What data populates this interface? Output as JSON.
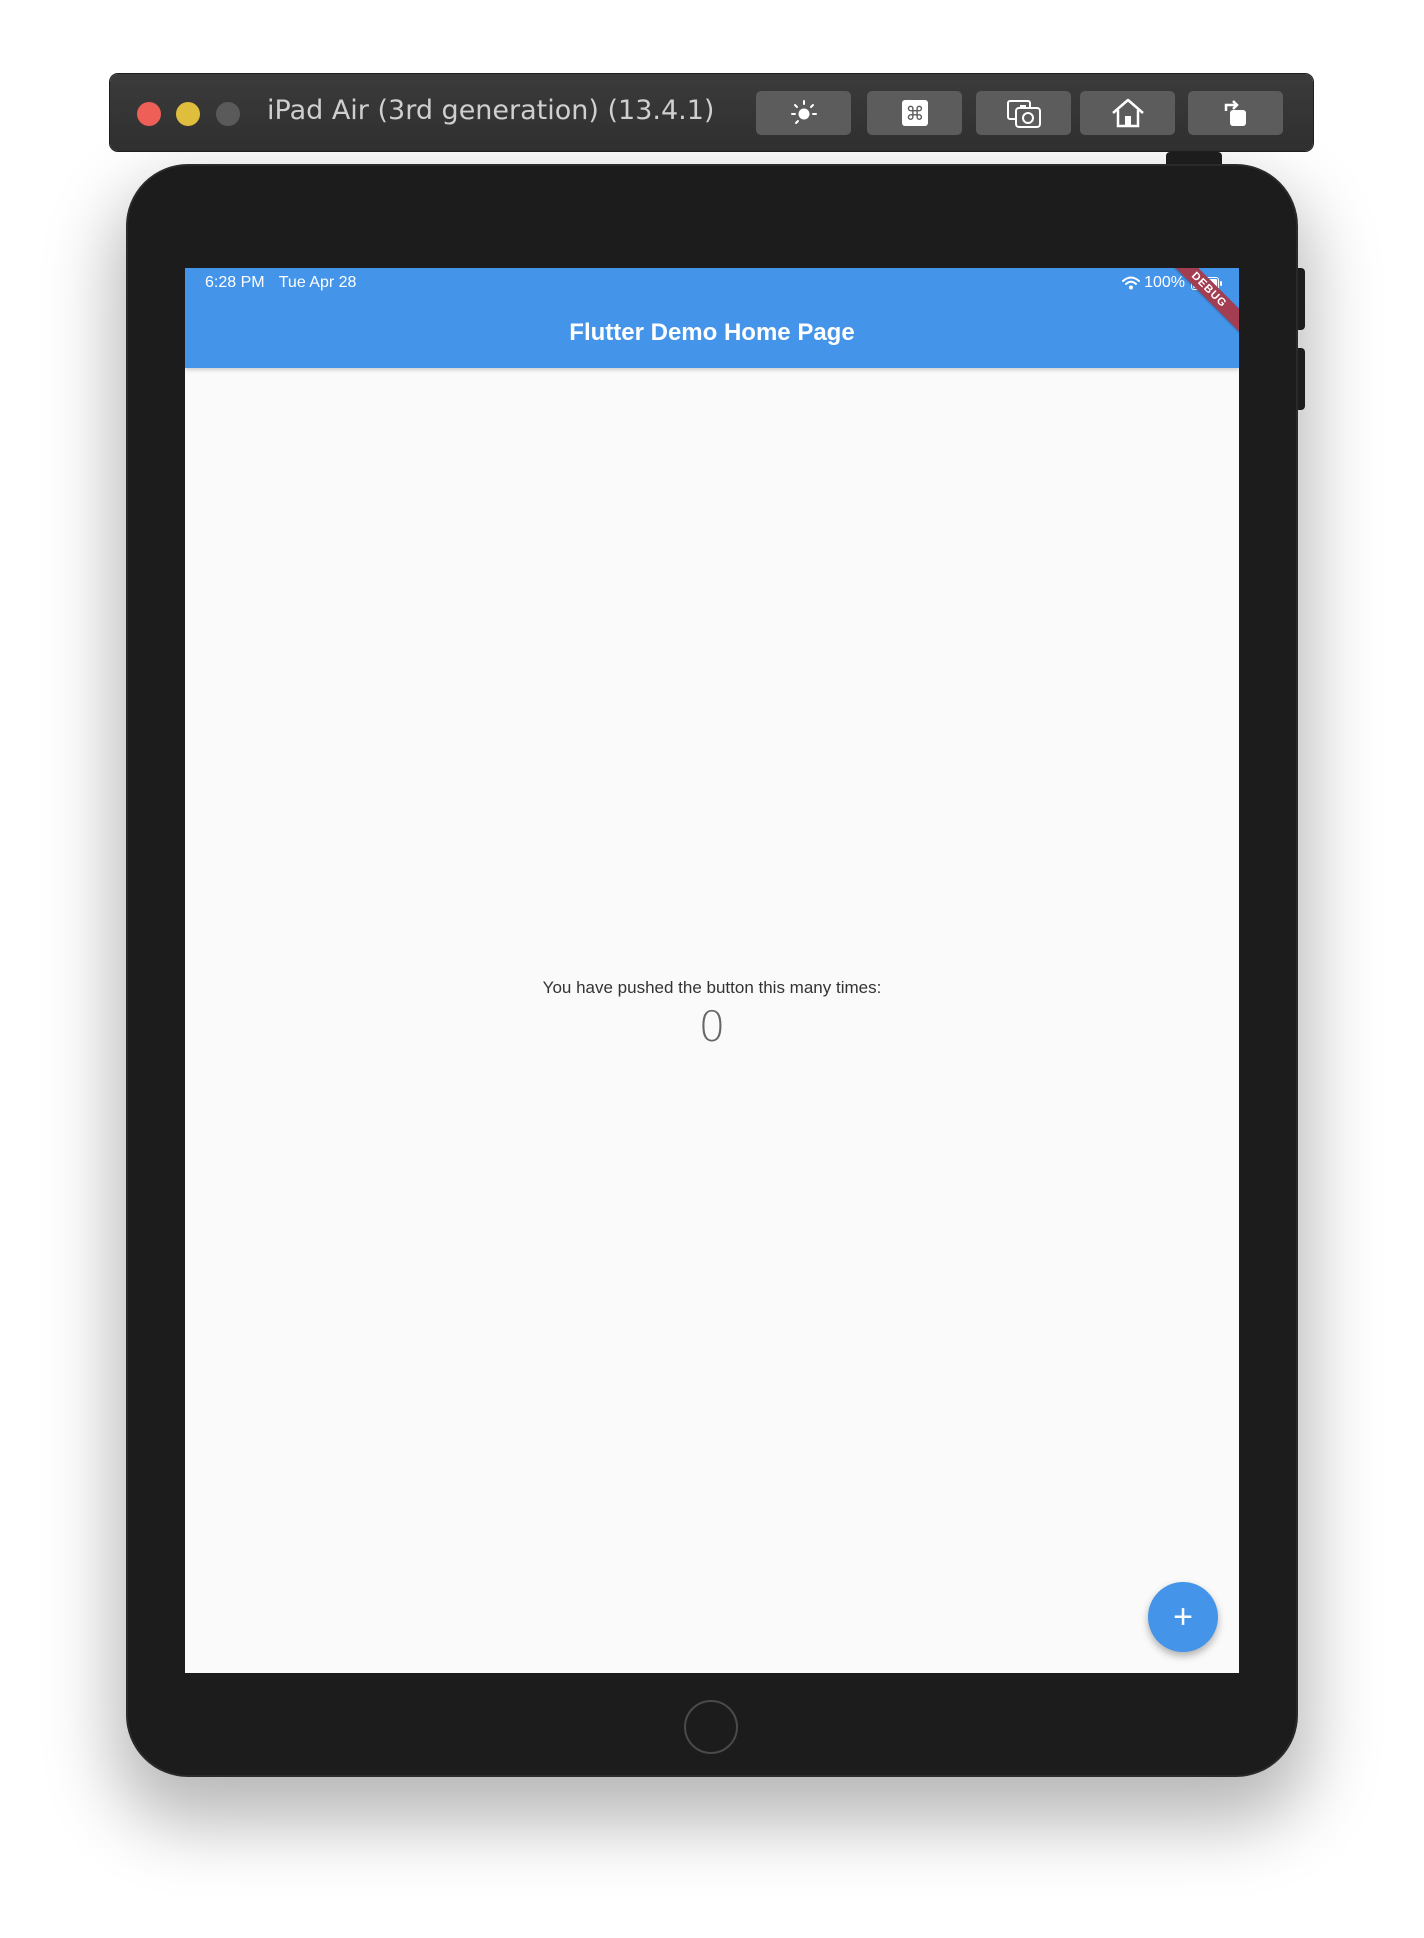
{
  "window": {
    "title": "iPad Air (3rd generation) (13.4.1)",
    "toolbar_icons": [
      "brightness-icon",
      "command-icon",
      "screenshot-icon",
      "home-icon",
      "rotate-icon"
    ]
  },
  "status_bar": {
    "time": "6:28 PM",
    "date": "Tue Apr 28",
    "battery": "100%"
  },
  "app_bar": {
    "title": "Flutter Demo Home Page",
    "color": "#4494e9"
  },
  "debug_banner": {
    "label": "DEBUG"
  },
  "body": {
    "counter_label": "You have pushed the button this many times:",
    "counter_value": "0"
  },
  "fab": {
    "label": "+"
  }
}
